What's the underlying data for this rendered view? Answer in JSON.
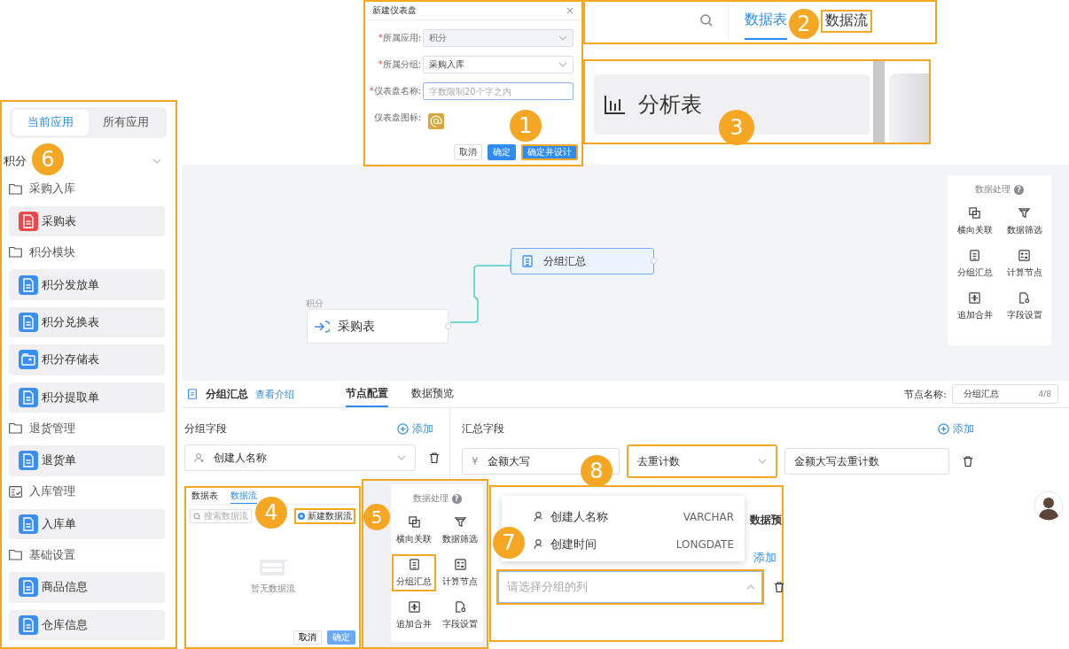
{
  "dialog": {
    "step": "1",
    "title": "新建仪表盘",
    "close": "×",
    "fields": [
      {
        "kind": "select",
        "mark": "*",
        "label": "所属应用:",
        "value": "积分",
        "disabled": true
      },
      {
        "kind": "select",
        "mark": "*",
        "label": "所属分组:",
        "value": "采购入库",
        "disabled": false
      },
      {
        "kind": "input",
        "mark": "*",
        "label": "仪表盘名称:",
        "placeholder": "字数限制20个字之内"
      },
      {
        "kind": "icon",
        "label": "仪表盘图标:"
      }
    ],
    "buttons": [
      {
        "label": "取消",
        "kind": "plain",
        "highlighted": false
      },
      {
        "label": "确定",
        "kind": "primary",
        "highlighted": false
      },
      {
        "label": "确定并设计",
        "kind": "primary",
        "highlighted": true
      }
    ]
  },
  "tab_strip": {
    "step": "2",
    "tabs": [
      {
        "label": "数据表",
        "selected": true,
        "highlighted": false
      },
      {
        "label": "数据流",
        "selected": false,
        "highlighted": true
      }
    ]
  },
  "card_strip": {
    "step": "3",
    "card": "分析表"
  },
  "sidebar": {
    "step": "6",
    "tabs": [
      {
        "label": "当前应用",
        "selected": true
      },
      {
        "label": "所有应用",
        "selected": false
      }
    ],
    "app": "积分",
    "groups": [
      {
        "name": "采购入库",
        "kind": "folder",
        "items": [
          {
            "label": "采购表",
            "kind": "doc",
            "color": "#f0474a"
          }
        ]
      },
      {
        "name": "积分模块",
        "kind": "folder",
        "items": [
          {
            "label": "积分发放单",
            "kind": "doc",
            "color": "#3a8ef6"
          },
          {
            "label": "积分兑换表",
            "kind": "doc",
            "color": "#3a8ef6"
          },
          {
            "label": "积分存储表",
            "kind": "card",
            "color": "#3a8ef6"
          },
          {
            "label": "积分提取单",
            "kind": "doc",
            "color": "#3a8ef6"
          }
        ]
      },
      {
        "name": "退货管理",
        "kind": "folder",
        "items": [
          {
            "label": "退货单",
            "kind": "doc",
            "color": "#3a8ef6"
          }
        ]
      },
      {
        "name": "入库管理",
        "kind": "checklist",
        "items": [
          {
            "label": "入库单",
            "kind": "doc",
            "color": "#3a8ef6"
          }
        ]
      },
      {
        "name": "基础设置",
        "kind": "folder",
        "items": [
          {
            "label": "商品信息",
            "kind": "doc",
            "color": "#3a8ef6"
          },
          {
            "label": "仓库信息",
            "kind": "doc",
            "color": "#3a8ef6"
          }
        ]
      }
    ]
  },
  "canvas": {
    "group_label": "积分",
    "nodes": [
      {
        "label": "采购表",
        "kind": "source",
        "selected": false
      },
      {
        "label": "分组汇总",
        "kind": "group",
        "selected": true
      }
    ],
    "toolbox": {
      "title": "数据处理",
      "help": "?",
      "tools": [
        {
          "label": "横向关联",
          "kind": "join",
          "highlighted": false
        },
        {
          "label": "数据筛选",
          "kind": "filter",
          "highlighted": false
        },
        {
          "label": "分组汇总",
          "kind": "group",
          "highlighted": false
        },
        {
          "label": "计算节点",
          "kind": "calc",
          "highlighted": false
        },
        {
          "label": "追加合并",
          "kind": "append",
          "highlighted": false
        },
        {
          "label": "字段设置",
          "kind": "fields",
          "highlighted": false
        }
      ]
    }
  },
  "config": {
    "step": "8",
    "title": "分组汇总",
    "link": "查看介绍",
    "tabs": [
      {
        "label": "节点配置",
        "selected": true
      },
      {
        "label": "数据预览",
        "selected": false
      }
    ],
    "name_label": "节点名称:",
    "name_value": "分组汇总",
    "name_count": "4/8",
    "group": {
      "title": "分组字段",
      "add": "添加",
      "fields": [
        "创建人名称"
      ]
    },
    "summary": {
      "title": "汇总字段",
      "add": "添加",
      "rows": [
        {
          "currency": "¥",
          "field": "金额大写",
          "method": "去重计数",
          "alias": "金额大写去重计数",
          "highlighted": true
        }
      ]
    }
  },
  "dataflow_dialog": {
    "step": "4",
    "tabs": [
      {
        "label": "数据表",
        "selected": false
      },
      {
        "label": "数据流",
        "selected": true
      }
    ],
    "search_placeholder": "搜索数据流",
    "new_button": {
      "label": "新建数据流",
      "highlighted": true
    },
    "empty": "暂无数据流",
    "buttons": [
      {
        "label": "取消",
        "kind": "plain"
      },
      {
        "label": "确定",
        "kind": "primary"
      }
    ]
  },
  "toolbox_inset": {
    "step": "5",
    "title": "数据处理",
    "help": "?",
    "tools": [
      {
        "label": "横向关联",
        "kind": "join",
        "highlighted": false
      },
      {
        "label": "数据筛选",
        "kind": "filter",
        "highlighted": false
      },
      {
        "label": "分组汇总",
        "kind": "group",
        "highlighted": true
      },
      {
        "label": "计算节点",
        "kind": "calc",
        "highlighted": false
      },
      {
        "label": "追加合并",
        "kind": "append",
        "highlighted": false
      },
      {
        "label": "字段设置",
        "kind": "fields",
        "highlighted": false
      }
    ]
  },
  "column_picker": {
    "step": "7",
    "behind_tab": "数据预",
    "add": "添加",
    "options": [
      {
        "label": "创建人名称",
        "type": "VARCHAR"
      },
      {
        "label": "创建时间",
        "type": "LONGDATE"
      }
    ],
    "placeholder": "请选择分组的列",
    "open": true,
    "highlighted": true
  }
}
